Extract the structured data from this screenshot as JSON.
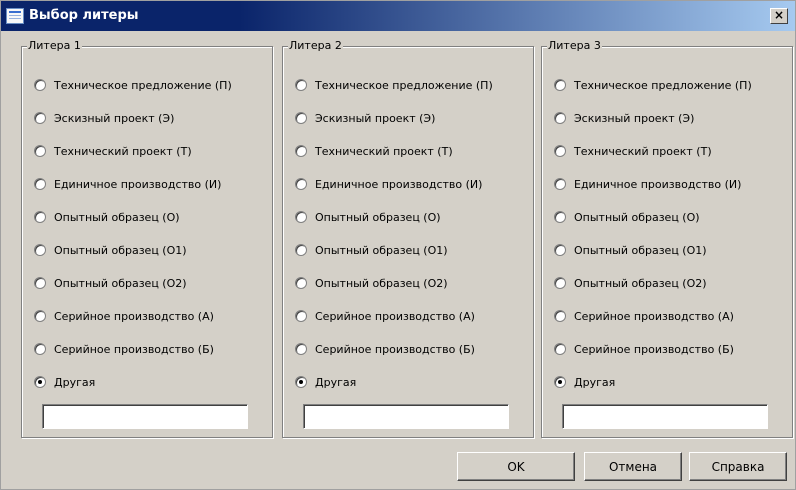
{
  "window": {
    "title": "Выбор литеры",
    "close_label": "×"
  },
  "groups": [
    {
      "label": "Литера 1",
      "options": [
        {
          "label": "Техническое предложение (П)",
          "checked": false
        },
        {
          "label": "Эскизный проект (Э)",
          "checked": false
        },
        {
          "label": "Технический проект (Т)",
          "checked": false
        },
        {
          "label": "Единичное производство (И)",
          "checked": false
        },
        {
          "label": "Опытный образец (О)",
          "checked": false
        },
        {
          "label": "Опытный образец (О1)",
          "checked": false
        },
        {
          "label": "Опытный образец (О2)",
          "checked": false
        },
        {
          "label": "Серийное производство (А)",
          "checked": false
        },
        {
          "label": "Серийное производство (Б)",
          "checked": false
        },
        {
          "label": "Другая",
          "checked": true
        }
      ],
      "custom_value": ""
    },
    {
      "label": "Литера 2",
      "options": [
        {
          "label": "Техническое предложение (П)",
          "checked": false
        },
        {
          "label": "Эскизный проект (Э)",
          "checked": false
        },
        {
          "label": "Технический проект (Т)",
          "checked": false
        },
        {
          "label": "Единичное производство (И)",
          "checked": false
        },
        {
          "label": "Опытный образец (О)",
          "checked": false
        },
        {
          "label": "Опытный образец (О1)",
          "checked": false
        },
        {
          "label": "Опытный образец (О2)",
          "checked": false
        },
        {
          "label": "Серийное производство (А)",
          "checked": false
        },
        {
          "label": "Серийное производство (Б)",
          "checked": false
        },
        {
          "label": "Другая",
          "checked": true
        }
      ],
      "custom_value": ""
    },
    {
      "label": "Литера 3",
      "options": [
        {
          "label": "Техническое предложение (П)",
          "checked": false
        },
        {
          "label": "Эскизный проект (Э)",
          "checked": false
        },
        {
          "label": "Технический проект (Т)",
          "checked": false
        },
        {
          "label": "Единичное производство (И)",
          "checked": false
        },
        {
          "label": "Опытный образец (О)",
          "checked": false
        },
        {
          "label": "Опытный образец (О1)",
          "checked": false
        },
        {
          "label": "Опытный образец (О2)",
          "checked": false
        },
        {
          "label": "Серийное производство (А)",
          "checked": false
        },
        {
          "label": "Серийное производство (Б)",
          "checked": false
        },
        {
          "label": "Другая",
          "checked": true
        }
      ],
      "custom_value": ""
    }
  ],
  "buttons": {
    "ok": "OK",
    "cancel": "Отмена",
    "help": "Справка"
  }
}
